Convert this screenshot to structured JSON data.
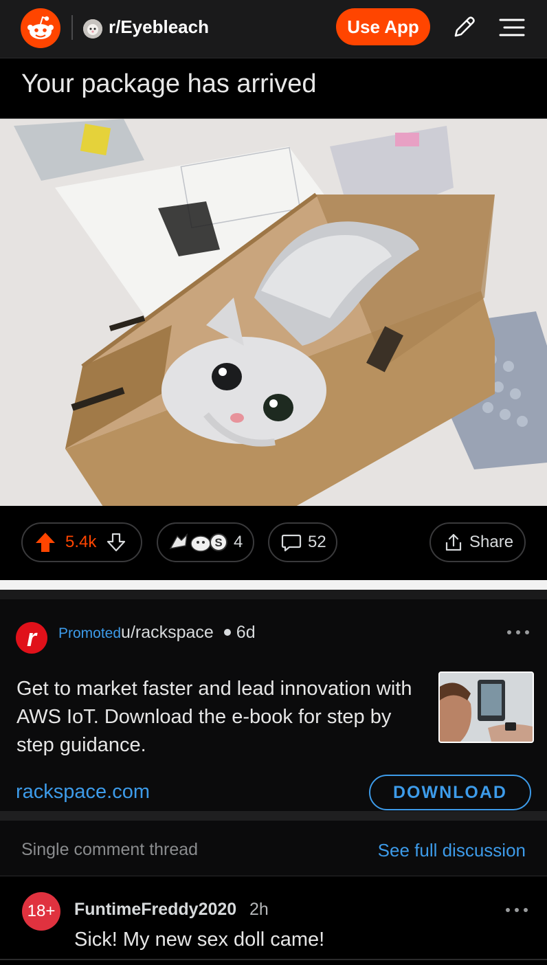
{
  "header": {
    "subreddit": "r/Eyebleach",
    "use_app_label": "Use App",
    "icons": [
      "reddit-logo-icon",
      "pencil-icon",
      "menu-icon"
    ]
  },
  "post": {
    "title": "Your package has arrived",
    "image_alt": "kitten-in-box",
    "score": "5.4k",
    "award_count": "4",
    "comment_count": "52",
    "share_label": "Share",
    "accent": "#ff4500"
  },
  "ad": {
    "promoted_label": "Promoted",
    "author": "u/rackspace",
    "age": "6d",
    "text": "Get to market faster and lead innovation with AWS IoT. Download the e-book for step by step guidance.",
    "domain": "rackspace.com",
    "cta": "DOWNLOAD",
    "logo_letter": "r"
  },
  "thread": {
    "label": "Single comment thread",
    "full_label": "See full discussion"
  },
  "comment": {
    "avatar_text": "18+",
    "author": "FuntimeFreddy2020",
    "age": "2h",
    "body": "Sick! My new sex doll came!"
  }
}
